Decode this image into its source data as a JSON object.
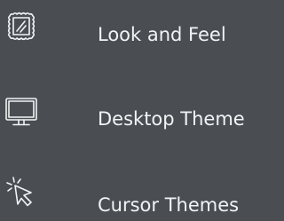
{
  "background_color": "#4a4e53",
  "text_color": "#f2f3f4",
  "items": [
    {
      "label": "Look and Feel",
      "icon": "picture-frame-icon"
    },
    {
      "label": "Desktop Theme",
      "icon": "monitor-icon"
    },
    {
      "label": "Cursor Themes",
      "icon": "cursor-pointer-icon"
    }
  ]
}
